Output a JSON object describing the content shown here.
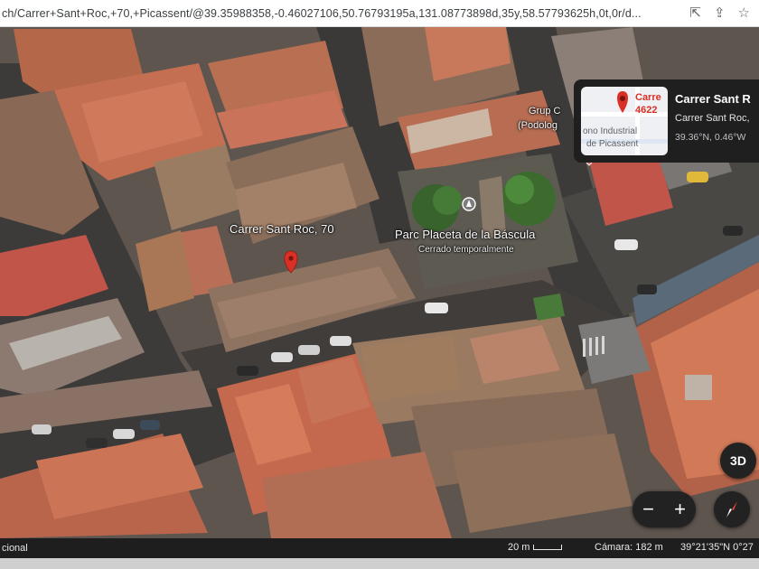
{
  "browser": {
    "url": "ch/Carrer+Sant+Roc,+70,+Picassent/@39.35988358,-0.46027106,50.76793195a,131.08773898d,35y,58.57793625h,0t,0r/d...",
    "icons": [
      "cast-icon",
      "share-icon",
      "star-icon"
    ]
  },
  "map": {
    "labels": {
      "address": "Carrer Sant Roc, 70",
      "park": "Parc Placeta de la Báscula",
      "park_status": "Cerrado temporalmente",
      "shop_line1": "Grup C",
      "shop_line2": "(Podolog"
    },
    "colors": {
      "pin": "#d93025",
      "roof_orange": "#c8694a",
      "roof_brown": "#8b6a55",
      "street": "#4a4a4a"
    }
  },
  "info_card": {
    "title": "Carrer Sant R",
    "subtitle": "Carrer Sant Roc,",
    "coords": "39.36°N, 0.46°W",
    "thumb_text1": "Carre",
    "thumb_text2": "4622",
    "thumb_text3": "ono Industrial",
    "thumb_text4": "de Picassent"
  },
  "controls": {
    "three_d": "3D",
    "zoom_out": "−",
    "zoom_in": "+"
  },
  "status": {
    "left": "cional",
    "scale": "20 m",
    "camera": "Cámara: 182 m",
    "coords": "39°21'35\"N 0°27"
  }
}
